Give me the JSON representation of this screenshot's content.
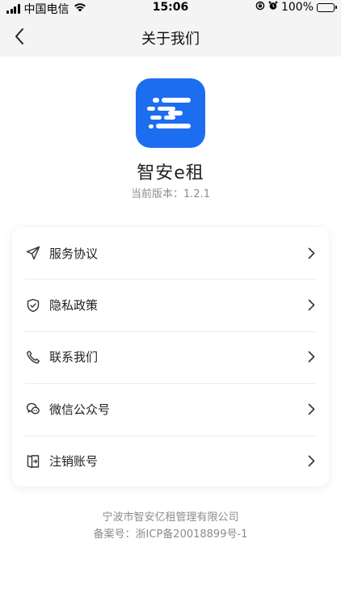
{
  "status_bar": {
    "carrier": "中国电信",
    "time": "15:06",
    "battery_pct": "100%",
    "battery_level": 1.0
  },
  "nav": {
    "title": "关于我们"
  },
  "app": {
    "name": "智安e租",
    "version": "当前版本：1.2.1",
    "brand_color": "#1d6df0"
  },
  "menu": {
    "items": [
      {
        "label": "服务协议",
        "icon": "paper-plane-icon"
      },
      {
        "label": "隐私政策",
        "icon": "shield-check-icon"
      },
      {
        "label": "联系我们",
        "icon": "phone-icon"
      },
      {
        "label": "微信公众号",
        "icon": "wechat-icon"
      },
      {
        "label": "注销账号",
        "icon": "logout-icon"
      }
    ]
  },
  "footer": {
    "company": "宁波市智安亿租管理有限公司",
    "icp": "备案号：浙ICP备20018899号-1"
  }
}
